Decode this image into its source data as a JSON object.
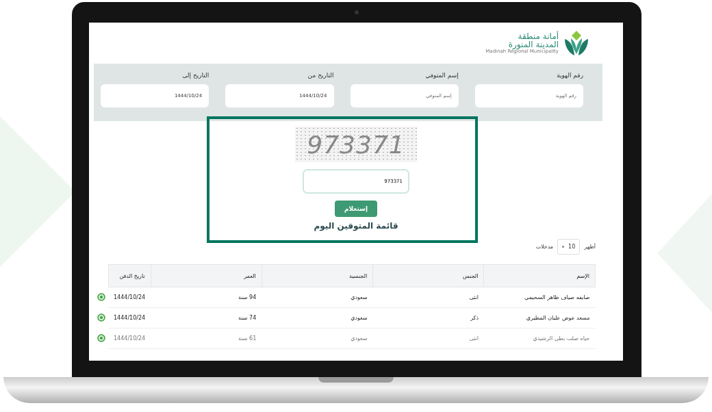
{
  "logo": {
    "title_line1": "أمانة منطقة",
    "title_line2": "المدينة المنورة",
    "subtitle": "Madinah Regional Municipality"
  },
  "filters": [
    {
      "label": "رقم الهوية",
      "placeholder": "رقم الهوية"
    },
    {
      "label": "إسم المتوفي",
      "placeholder": "إسم المتوفي"
    },
    {
      "label": "التاريخ من",
      "value": "1444/10/24"
    },
    {
      "label": "التاريخ إلى",
      "value": "1444/10/24"
    }
  ],
  "captcha": {
    "code": "973371",
    "input_value": "973371",
    "button": "إستعلام"
  },
  "list_title": "قائمة المتوفين اليوم",
  "page_length": {
    "prefix": "أظهر",
    "value": "10",
    "suffix": "مدخلات"
  },
  "table": {
    "columns": [
      "الإسم",
      "الجنس",
      "الجنسية",
      "العمر",
      "تاريخ الدفن"
    ],
    "rows": [
      {
        "cells": [
          "صايفه صياف ظاهر السحيمي",
          "انثى",
          "سعودي",
          "94 سنة",
          "1444/10/24"
        ],
        "faded": false
      },
      {
        "cells": [
          "مسعد عوض عليان المطيري",
          "ذكر",
          "سعودي",
          "74 سنة",
          "1444/10/24"
        ],
        "faded": false
      },
      {
        "cells": [
          "حياه صلت بطي الرشيدي",
          "انثى",
          "سعودي",
          "61 سنة",
          "1444/10/24"
        ],
        "faded": true
      }
    ]
  }
}
